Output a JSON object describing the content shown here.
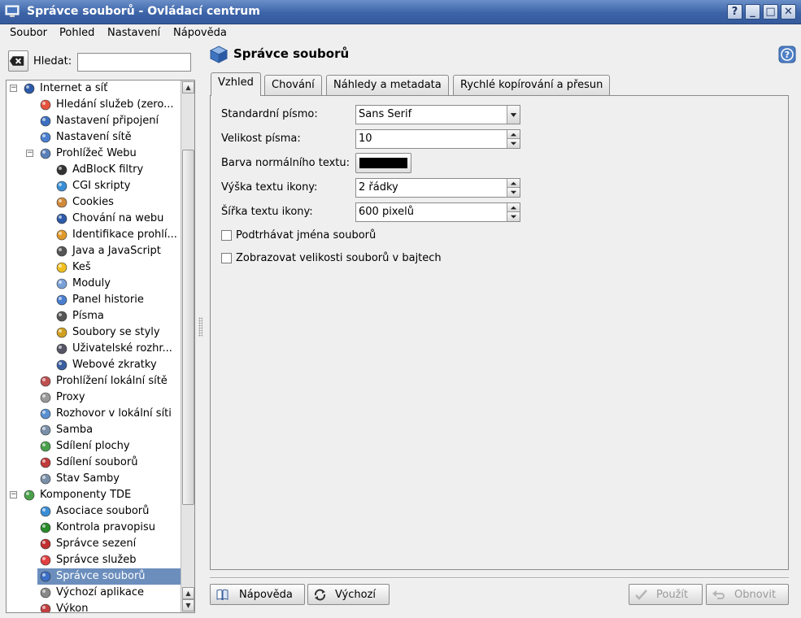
{
  "window": {
    "title": "Správce souborů - Ovládací centrum"
  },
  "title_buttons": [
    "?",
    "_",
    "□",
    "✕"
  ],
  "menu": [
    "Soubor",
    "Pohled",
    "Nastavení",
    "Nápověda"
  ],
  "search": {
    "label": "Hledat:",
    "value": ""
  },
  "tree": {
    "items": [
      {
        "label": "Internet a síť"
      },
      {
        "label": "Hledání služeb (zero..."
      },
      {
        "label": "Nastavení připojení"
      },
      {
        "label": "Nastavení sítě"
      },
      {
        "label": "Prohlížeč Webu"
      },
      {
        "label": "AdBlocK filtry"
      },
      {
        "label": "CGI skripty"
      },
      {
        "label": "Cookies"
      },
      {
        "label": "Chování na webu"
      },
      {
        "label": "Identifikace prohlí..."
      },
      {
        "label": "Java a JavaScript"
      },
      {
        "label": "Keš"
      },
      {
        "label": "Moduly"
      },
      {
        "label": "Panel historie"
      },
      {
        "label": "Písma"
      },
      {
        "label": "Soubory se styly"
      },
      {
        "label": "Uživatelské rozhr..."
      },
      {
        "label": "Webové zkratky"
      },
      {
        "label": "Prohlížení lokální sítě"
      },
      {
        "label": "Proxy"
      },
      {
        "label": "Rozhovor v lokální síti"
      },
      {
        "label": "Samba"
      },
      {
        "label": "Sdílení plochy"
      },
      {
        "label": "Sdílení souborů"
      },
      {
        "label": "Stav Samby"
      },
      {
        "label": "Komponenty TDE"
      },
      {
        "label": "Asociace souborů"
      },
      {
        "label": "Kontrola pravopisu"
      },
      {
        "label": "Správce sezení"
      },
      {
        "label": "Správce služeb"
      },
      {
        "label": "Správce souborů"
      },
      {
        "label": "Výchozí aplikace"
      },
      {
        "label": "Výkon"
      }
    ]
  },
  "module": {
    "title": "Správce souborů"
  },
  "tabs": [
    {
      "label": "Vzhled"
    },
    {
      "label": "Chování"
    },
    {
      "label": "Náhledy a metadata"
    },
    {
      "label": "Rychlé kopírování a přesun"
    }
  ],
  "form": {
    "standard_font_label": "Standardní písmo:",
    "standard_font_value": "Sans Serif",
    "font_size_label": "Velikost písma:",
    "font_size_value": "10",
    "text_color_label": "Barva normálního textu:",
    "text_color": "#000000",
    "icon_text_height_label": "Výška textu ikony:",
    "icon_text_height_value": "2 řádky",
    "icon_text_width_label": "Šířka textu ikony:",
    "icon_text_width_value": "600 pixelů",
    "underline_label": "Podtrhávat jména souborů",
    "underline_checked": false,
    "bytes_label": "Zobrazovat velikosti souborů v bajtech",
    "bytes_checked": false
  },
  "buttons": {
    "help": "Nápověda",
    "defaults": "Výchozí",
    "apply": "Použít",
    "reset": "Obnovit"
  },
  "colors": {
    "titlebar": "#3d64a8",
    "selection": "#6b8ebd"
  }
}
